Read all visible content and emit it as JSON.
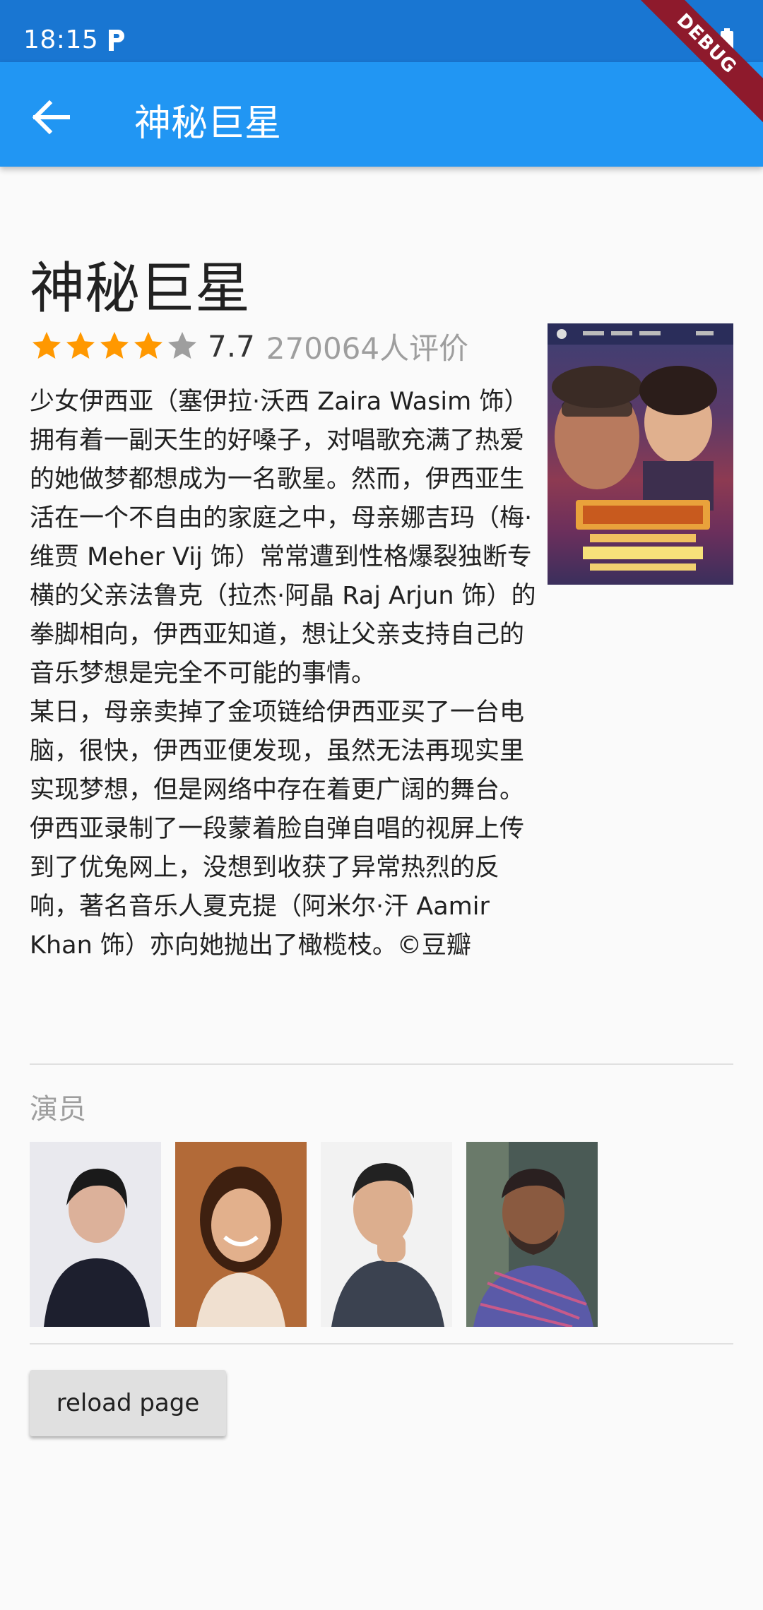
{
  "status_bar": {
    "time": "18:15",
    "debug_label": "DEBUG"
  },
  "app_bar": {
    "title": "神秘巨星"
  },
  "movie": {
    "title": "神秘巨星",
    "rating": {
      "stars_filled": 4,
      "stars_total": 5,
      "value": "7.7",
      "count_label": "270064人评价"
    },
    "synopsis": "少女伊西亚（塞伊拉·沃西 Zaira Wasim 饰）拥有着一副天生的好嗓子，对唱歌充满了热爱的她做梦都想成为一名歌星。然而，伊西亚生活在一个不自由的家庭之中，母亲娜吉玛（梅·维贾 Meher Vij 饰）常常遭到性格爆裂独断专横的父亲法鲁克（拉杰·阿晶 Raj Arjun 饰）的拳脚相向，伊西亚知道，想让父亲支持自己的音乐梦想是完全不可能的事情。\n某日，母亲卖掉了金项链给伊西亚买了一台电脑，很快，伊西亚便发现，虽然无法再现实里实现梦想，但是网络中存在着更广阔的舞台。伊西亚录制了一段蒙着脸自弹自唱的视屏上传到了优兔网上，没想到收获了异常热烈的反响，著名音乐人夏克提（阿米尔·汗 Aamir Khan 饰）亦向她抛出了橄榄枝。©豆瓣"
  },
  "cast": {
    "section_label": "演员",
    "count": 4
  },
  "reload_button": {
    "label": "reload page"
  },
  "colors": {
    "primary": "#2196f3",
    "status": "#1976d2",
    "star": "#ff9800",
    "star_empty": "#9e9e9e"
  }
}
